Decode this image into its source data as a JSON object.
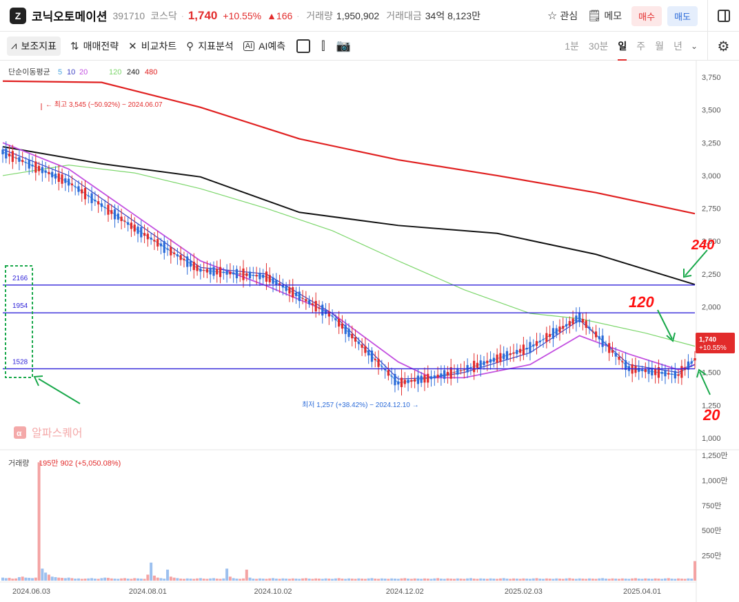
{
  "header": {
    "logo_text": "Z",
    "stock_name": "코닉오토메이션",
    "code": "391710",
    "market": "코스닥",
    "price": "1,740",
    "change_pct": "+10.55%",
    "change_abs": "▲166",
    "volume_label": "거래량",
    "volume_value": "1,950,902",
    "amount_label": "거래대금",
    "amount_value": "34억 8,123만",
    "watch_label": "관심",
    "memo_label": "메모",
    "buy_label": "매수",
    "sell_label": "매도"
  },
  "toolbar": {
    "indicators_label": "보조지표",
    "strategy_label": "매매전략",
    "compare_label": "비교차트",
    "analysis_label": "지표분석",
    "ai_label": "AI예측",
    "periods": [
      "1분",
      "30분",
      "일",
      "주",
      "월",
      "년"
    ],
    "active_period": "일"
  },
  "colors": {
    "up": "#e22b2b",
    "down": "#2a6ad8",
    "ma5": "#4aa3df",
    "ma10": "#3b3fc4",
    "ma20": "#c24ee0",
    "ma120": "#7bd66a",
    "ma240": "#111111",
    "ma480": "#e02020",
    "hline": "#2f22d8",
    "annotation": "#18a84a",
    "handwriting": "#ff1111"
  },
  "chart_data": [
    {
      "type": "line",
      "title": "단순이동평균",
      "legend": {
        "title": "단순이동평균",
        "periods": [
          "5",
          "10",
          "20",
          "120",
          "240",
          "480"
        ]
      },
      "y_axis": {
        "min": 1000,
        "max": 3750,
        "ticks": [
          "3,750",
          "3,500",
          "3,250",
          "3,000",
          "2,750",
          "2,500",
          "2,250",
          "2,000",
          "1,750",
          "1,500",
          "1,250",
          "1,000"
        ]
      },
      "x_axis": {
        "ticks": [
          "2024.06.03",
          "2024.08.01",
          "2024.10.02",
          "2024.12.02",
          "2025.02.03",
          "2025.04.01"
        ]
      },
      "last_price": {
        "value": "1,740",
        "change": "+10.55%"
      },
      "high_annotation": "최고 3,545 (−50.92%) − 2024.06.07",
      "low_annotation": "최저 1,257 (+38.42%) − 2024.12.10",
      "horizontal_levels": [
        {
          "label": "2166",
          "value": 2166
        },
        {
          "label": "1954",
          "value": 1954
        },
        {
          "label": "1528",
          "value": 1528
        }
      ],
      "handwritten_labels": [
        "240",
        "120",
        "20"
      ],
      "watermark": "알파스퀘어",
      "series": [
        {
          "name": "480",
          "x": [
            0,
            30,
            60,
            90,
            120,
            150,
            180,
            210
          ],
          "values": [
            3720,
            3710,
            3520,
            3280,
            3120,
            3000,
            2870,
            2710
          ]
        },
        {
          "name": "240",
          "x": [
            0,
            30,
            60,
            90,
            120,
            150,
            180,
            210
          ],
          "values": [
            3220,
            3090,
            2990,
            2720,
            2620,
            2560,
            2400,
            2170
          ]
        },
        {
          "name": "120",
          "x": [
            0,
            20,
            40,
            60,
            80,
            100,
            120,
            140,
            160,
            175,
            195,
            210
          ],
          "values": [
            3000,
            3080,
            3020,
            2900,
            2750,
            2580,
            2350,
            2130,
            1950,
            1910,
            1800,
            1700
          ]
        },
        {
          "name": "20",
          "x": [
            0,
            20,
            40,
            60,
            80,
            100,
            120,
            130,
            140,
            160,
            175,
            190,
            205,
            210
          ],
          "values": [
            3250,
            3050,
            2700,
            2350,
            2160,
            1950,
            1580,
            1460,
            1460,
            1560,
            1780,
            1640,
            1520,
            1560
          ]
        },
        {
          "name": "10",
          "x": [
            0,
            20,
            40,
            60,
            80,
            100,
            120,
            130,
            140,
            160,
            175,
            190,
            205,
            210
          ],
          "values": [
            3200,
            3000,
            2650,
            2300,
            2250,
            1950,
            1450,
            1460,
            1500,
            1650,
            1900,
            1560,
            1500,
            1560
          ]
        },
        {
          "name": "5",
          "x": [
            0,
            20,
            40,
            60,
            80,
            100,
            120,
            130,
            140,
            160,
            175,
            190,
            205,
            210
          ],
          "values": [
            3180,
            2950,
            2600,
            2280,
            2230,
            1930,
            1420,
            1460,
            1520,
            1690,
            1920,
            1530,
            1480,
            1600
          ]
        }
      ]
    },
    {
      "type": "bar",
      "title": "거래량",
      "legend_value": "195만 902 (+5,050.08%)",
      "y_axis": {
        "min": 0,
        "max": 1250,
        "unit": "만",
        "ticks": [
          "1,250만",
          "1,000만",
          "750만",
          "500만",
          "250만"
        ]
      },
      "x": [
        0,
        1,
        2,
        3,
        4,
        5,
        6,
        7,
        8,
        9,
        10,
        11,
        12,
        13,
        14,
        15,
        16,
        17,
        18,
        19,
        20,
        21,
        22,
        23,
        24,
        25,
        26,
        27,
        28,
        29,
        30,
        31,
        32,
        33,
        34,
        35,
        36,
        37,
        38,
        39,
        40,
        41,
        42,
        43,
        44,
        45,
        46,
        47,
        48,
        49,
        50,
        51,
        52,
        53,
        54,
        55,
        56,
        57,
        58,
        59,
        60,
        61,
        62,
        63,
        64,
        65,
        66,
        67,
        68,
        69,
        70,
        71,
        72,
        73,
        74,
        75,
        76,
        77,
        78,
        79,
        80,
        81,
        82,
        83,
        84,
        85,
        86,
        87,
        88,
        89,
        90,
        91,
        92,
        93,
        94,
        95,
        96,
        97,
        98,
        99,
        100,
        101,
        102,
        103,
        104,
        105,
        106,
        107,
        108,
        109,
        110,
        111,
        112,
        113,
        114,
        115,
        116,
        117,
        118,
        119,
        120,
        121,
        122,
        123,
        124,
        125,
        126,
        127,
        128,
        129,
        130,
        131,
        132,
        133,
        134,
        135,
        136,
        137,
        138,
        139,
        140,
        141,
        142,
        143,
        144,
        145,
        146,
        147,
        148,
        149,
        150,
        151,
        152,
        153,
        154,
        155,
        156,
        157,
        158,
        159,
        160,
        161,
        162,
        163,
        164,
        165,
        166,
        167,
        168,
        169,
        170,
        171,
        172,
        173,
        174,
        175,
        176,
        177,
        178,
        179,
        180,
        181,
        182,
        183,
        184,
        185,
        186,
        187,
        188,
        189,
        190,
        191,
        192,
        193,
        194,
        195,
        196,
        197,
        198,
        199,
        200,
        201,
        202,
        203,
        204,
        205,
        206,
        207,
        208,
        209,
        210
      ],
      "values": [
        30,
        25,
        28,
        20,
        22,
        35,
        40,
        30,
        28,
        25,
        30,
        1180,
        120,
        80,
        60,
        40,
        35,
        30,
        28,
        25,
        30,
        25,
        20,
        22,
        18,
        20,
        22,
        25,
        20,
        18,
        25,
        30,
        28,
        22,
        20,
        18,
        22,
        25,
        20,
        18,
        25,
        22,
        20,
        18,
        60,
        180,
        50,
        30,
        25,
        20,
        110,
        40,
        30,
        25,
        20,
        18,
        22,
        20,
        18,
        22,
        25,
        20,
        18,
        22,
        25,
        20,
        18,
        22,
        120,
        40,
        25,
        20,
        18,
        22,
        110,
        30,
        20,
        18,
        22,
        20,
        18,
        22,
        25,
        20,
        18,
        22,
        20,
        18,
        22,
        20,
        18,
        22,
        25,
        20,
        18,
        22,
        20,
        18,
        22,
        20,
        18,
        22,
        25,
        20,
        18,
        22,
        20,
        18,
        22,
        20,
        18,
        22,
        25,
        20,
        18,
        22,
        20,
        18,
        22,
        20,
        18,
        22,
        25,
        20,
        18,
        22,
        20,
        18,
        22,
        20,
        18,
        22,
        25,
        20,
        18,
        22,
        20,
        18,
        22,
        20,
        18,
        22,
        25,
        20,
        18,
        22,
        20,
        18,
        22,
        20,
        18,
        22,
        25,
        20,
        18,
        22,
        20,
        18,
        22,
        20,
        18,
        22,
        25,
        20,
        18,
        22,
        20,
        18,
        22,
        20,
        18,
        22,
        25,
        20,
        18,
        22,
        20,
        18,
        22,
        20,
        18,
        22,
        25,
        20,
        18,
        22,
        20,
        18,
        22,
        20,
        18,
        22,
        25,
        20,
        18,
        22,
        20,
        18,
        22,
        20,
        18,
        22,
        25,
        20,
        18,
        22,
        20,
        18,
        22,
        20,
        195
      ],
      "x_axis": {
        "ticks": [
          "2024.06.03",
          "2024.08.01",
          "2024.10.02",
          "2024.12.02",
          "2025.02.03",
          "2025.04.01"
        ]
      }
    }
  ]
}
